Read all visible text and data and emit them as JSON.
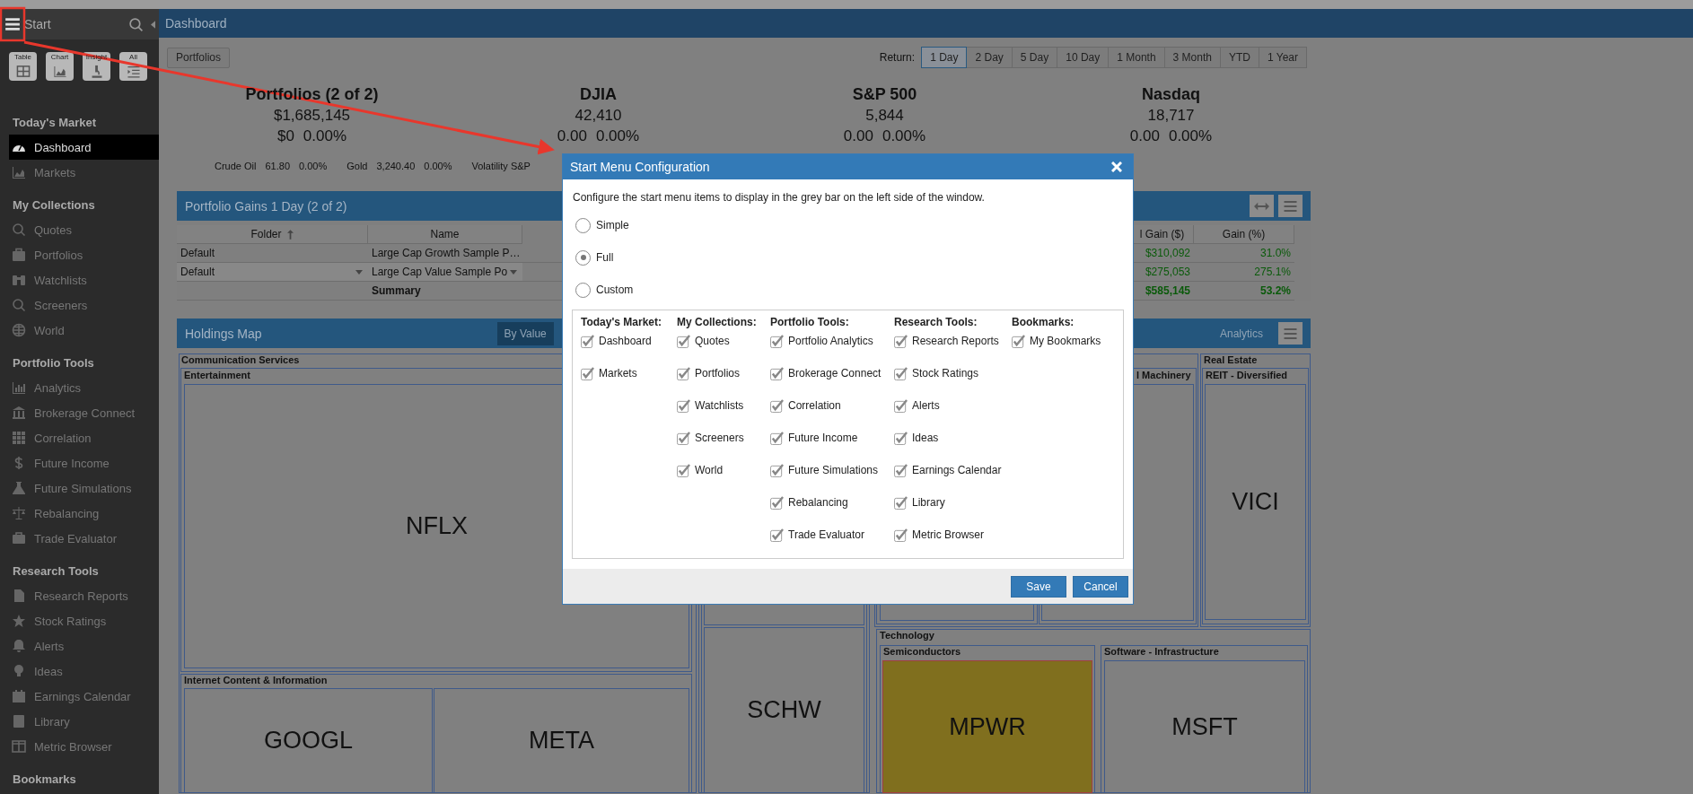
{
  "sidebar": {
    "title": "Start",
    "quick_buttons": [
      "Table",
      "Chart",
      "Insight",
      "All"
    ],
    "sections": [
      {
        "title": "Today's Market",
        "items": [
          {
            "label": "Dashboard",
            "selected": true
          },
          {
            "label": "Markets",
            "selected": false
          }
        ]
      },
      {
        "title": "My Collections",
        "items": [
          {
            "label": "Quotes",
            "selected": false
          },
          {
            "label": "Portfolios",
            "selected": false
          },
          {
            "label": "Watchlists",
            "selected": false
          },
          {
            "label": "Screeners",
            "selected": false
          },
          {
            "label": "World",
            "selected": false
          }
        ]
      },
      {
        "title": "Portfolio Tools",
        "items": [
          {
            "label": "Analytics",
            "selected": false
          },
          {
            "label": "Brokerage Connect",
            "selected": false
          },
          {
            "label": "Correlation",
            "selected": false
          },
          {
            "label": "Future Income",
            "selected": false
          },
          {
            "label": "Future Simulations",
            "selected": false
          },
          {
            "label": "Rebalancing",
            "selected": false
          },
          {
            "label": "Trade Evaluator",
            "selected": false
          }
        ]
      },
      {
        "title": "Research Tools",
        "items": [
          {
            "label": "Research Reports",
            "selected": false
          },
          {
            "label": "Stock Ratings",
            "selected": false
          },
          {
            "label": "Alerts",
            "selected": false
          },
          {
            "label": "Ideas",
            "selected": false
          },
          {
            "label": "Earnings Calendar",
            "selected": false
          },
          {
            "label": "Library",
            "selected": false
          },
          {
            "label": "Metric Browser",
            "selected": false
          }
        ]
      },
      {
        "title": "Bookmarks"
      }
    ]
  },
  "header": {
    "title": "Dashboard"
  },
  "toolbar": {
    "portfolios_button": "Portfolios",
    "return_label": "Return:",
    "periods": [
      {
        "label": "1 Day",
        "selected": true
      },
      {
        "label": "2 Day",
        "selected": false
      },
      {
        "label": "5 Day",
        "selected": false
      },
      {
        "label": "10 Day",
        "selected": false
      },
      {
        "label": "1 Month",
        "selected": false
      },
      {
        "label": "3 Month",
        "selected": false
      },
      {
        "label": "YTD",
        "selected": false
      },
      {
        "label": "1 Year",
        "selected": false
      }
    ]
  },
  "summary": [
    {
      "title": "Portfolios (2 of 2)",
      "value": "$1,685,145",
      "change": "$0",
      "percent": "0.00%"
    },
    {
      "title": "DJIA",
      "value": "42,410",
      "change": "0.00",
      "percent": "0.00%"
    },
    {
      "title": "S&P 500",
      "value": "5,844",
      "change": "0.00",
      "percent": "0.00%"
    },
    {
      "title": "Nasdaq",
      "value": "18,717",
      "change": "0.00",
      "percent": "0.00%"
    }
  ],
  "ticker": [
    {
      "name": "Crude Oil",
      "value": "61.80",
      "change": "0.00%"
    },
    {
      "name": "Gold",
      "value": "3,240.40",
      "change": "0.00%"
    },
    {
      "name": "Volatility S&P"
    }
  ],
  "gains_panel": {
    "title": "Portfolio Gains 1 Day (2 of 2)",
    "columns": [
      {
        "label": "Folder",
        "sorted": true
      },
      {
        "label": "Name",
        "sorted": false
      },
      {
        "label": "l Gain ($)",
        "sorted": false
      },
      {
        "label": "Gain (%)",
        "sorted": false
      }
    ],
    "rows": [
      {
        "folder": "Default",
        "name": "Large Cap Growth Sample P…",
        "gain": "$310,092",
        "gain_pct": "31.0%",
        "editing": false
      },
      {
        "folder": "Default",
        "name": "Large Cap Value Sample Po",
        "gain": "$275,053",
        "gain_pct": "275.1%",
        "editing": true
      }
    ],
    "summary": {
      "label": "Summary",
      "gain": "$585,145",
      "gain_pct": "53.2%"
    }
  },
  "holdings_panel": {
    "title": "Holdings Map",
    "view_button": "By Value",
    "analytics_label": "Analytics",
    "treemap": {
      "sectors": [
        "Communication Services",
        "Real Estate",
        "Technology"
      ],
      "industries": [
        "Entertainment",
        "Internet Content & Information",
        "l Machinery",
        "REIT - Diversified",
        "Semiconductors",
        "Software - Infrastructure"
      ],
      "tiles": [
        {
          "symbol": "NFLX",
          "highlighted": false
        },
        {
          "symbol": "GOOGL",
          "highlighted": false
        },
        {
          "symbol": "META",
          "highlighted": false
        },
        {
          "symbol": "SCHW",
          "highlighted": false
        },
        {
          "symbol": "VICI",
          "highlighted": false
        },
        {
          "symbol": "MPWR",
          "highlighted": true
        },
        {
          "symbol": "MSFT",
          "highlighted": false
        }
      ]
    }
  },
  "dialog": {
    "title": "Start Menu Configuration",
    "description": "Configure the start menu items to display in the grey bar on the left side of the window.",
    "modes": [
      {
        "label": "Simple",
        "selected": false
      },
      {
        "label": "Full",
        "selected": true
      },
      {
        "label": "Custom",
        "selected": false
      }
    ],
    "groups": [
      {
        "title": "Today's Market:",
        "items": [
          {
            "label": "Dashboard",
            "checked": true
          },
          {
            "label": "Markets",
            "checked": true
          }
        ]
      },
      {
        "title": "My Collections:",
        "items": [
          {
            "label": "Quotes",
            "checked": true
          },
          {
            "label": "Portfolios",
            "checked": true
          },
          {
            "label": "Watchlists",
            "checked": true
          },
          {
            "label": "Screeners",
            "checked": true
          },
          {
            "label": "World",
            "checked": true
          }
        ]
      },
      {
        "title": "Portfolio Tools:",
        "items": [
          {
            "label": "Portfolio Analytics",
            "checked": true
          },
          {
            "label": "Brokerage Connect",
            "checked": true
          },
          {
            "label": "Correlation",
            "checked": true
          },
          {
            "label": "Future Income",
            "checked": true
          },
          {
            "label": "Future Simulations",
            "checked": true
          },
          {
            "label": "Rebalancing",
            "checked": true
          },
          {
            "label": "Trade Evaluator",
            "checked": true
          }
        ]
      },
      {
        "title": "Research Tools:",
        "items": [
          {
            "label": "Research Reports",
            "checked": true
          },
          {
            "label": "Stock Ratings",
            "checked": true
          },
          {
            "label": "Alerts",
            "checked": true
          },
          {
            "label": "Ideas",
            "checked": true
          },
          {
            "label": "Earnings Calendar",
            "checked": true
          },
          {
            "label": "Library",
            "checked": true
          },
          {
            "label": "Metric Browser",
            "checked": true
          }
        ]
      },
      {
        "title": "Bookmarks:",
        "items": [
          {
            "label": "My Bookmarks",
            "checked": true
          }
        ]
      }
    ],
    "buttons": [
      "Save",
      "Cancel"
    ]
  }
}
